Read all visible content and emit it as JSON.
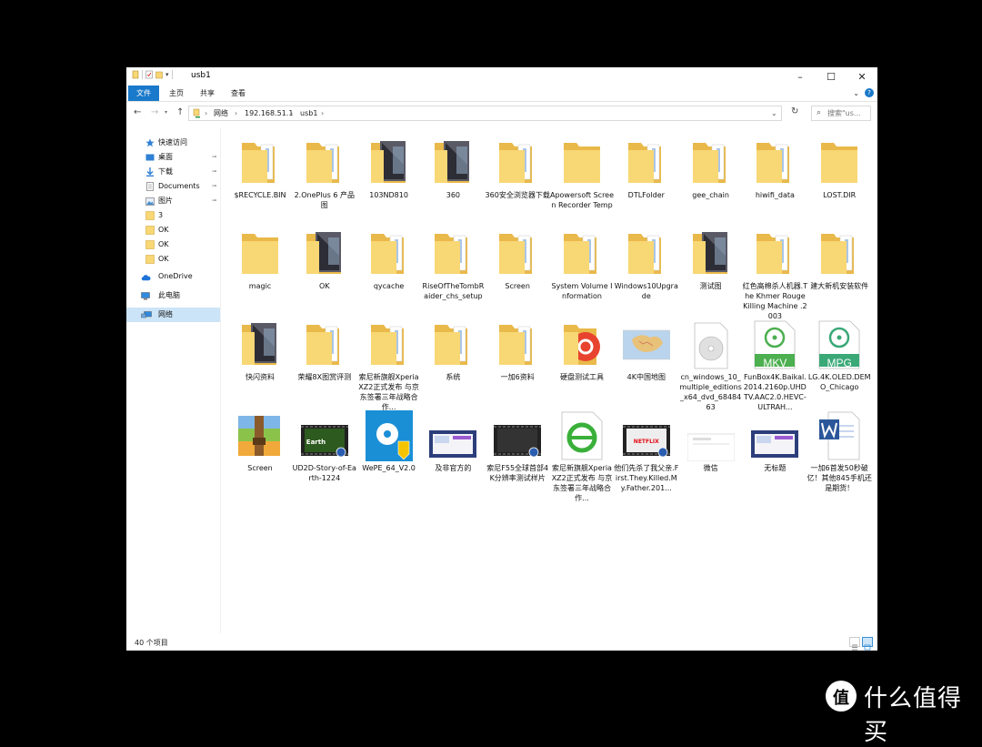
{
  "window": {
    "title": "usb1",
    "minimize": "–",
    "maximize": "☐",
    "close": "✕"
  },
  "ribbon": {
    "tabs": [
      "文件",
      "主页",
      "共享",
      "查看"
    ],
    "collapse": "⌄",
    "help": "?"
  },
  "address": {
    "crumbs": [
      "网络",
      "192.168.51.1",
      "usb1"
    ],
    "search_placeholder": "搜索\"us...",
    "back": "←",
    "forward": "→",
    "up": "↑",
    "refresh": "↻",
    "dropdown": "⌄"
  },
  "sidebar": {
    "items": [
      {
        "label": "快速访问",
        "icon": "star-icon",
        "pinned": false,
        "selected": false
      },
      {
        "label": "桌面",
        "icon": "desktop-icon",
        "pinned": true,
        "selected": false
      },
      {
        "label": "下载",
        "icon": "download-icon",
        "pinned": true,
        "selected": false
      },
      {
        "label": "Documents",
        "icon": "documents-icon",
        "pinned": true,
        "selected": false
      },
      {
        "label": "图片",
        "icon": "pictures-icon",
        "pinned": true,
        "selected": false
      },
      {
        "label": "3",
        "icon": "folder-icon",
        "pinned": false,
        "selected": false
      },
      {
        "label": "OK",
        "icon": "folder-icon",
        "pinned": false,
        "selected": false
      },
      {
        "label": "OK",
        "icon": "folder-icon",
        "pinned": false,
        "selected": false
      },
      {
        "label": "OK",
        "icon": "folder-icon",
        "pinned": false,
        "selected": false
      },
      {
        "label": "OneDrive",
        "icon": "cloud-icon",
        "pinned": false,
        "selected": false
      },
      {
        "label": "此电脑",
        "icon": "computer-icon",
        "pinned": false,
        "selected": false
      },
      {
        "label": "网络",
        "icon": "network-icon",
        "pinned": false,
        "selected": true
      }
    ],
    "pin_glyph": "📌"
  },
  "files": [
    {
      "name": "$RECYCLE.BIN",
      "type": "folder"
    },
    {
      "name": "2.OnePlus 6 产品图",
      "type": "folder"
    },
    {
      "name": "103ND810",
      "type": "folder-photo"
    },
    {
      "name": "360",
      "type": "folder-photo"
    },
    {
      "name": "360安全浏览器下载",
      "type": "folder"
    },
    {
      "name": "Apowersoft Screen Recorder Temp",
      "type": "folder-empty"
    },
    {
      "name": "DTLFolder",
      "type": "folder"
    },
    {
      "name": "gee_chain",
      "type": "folder"
    },
    {
      "name": "hiwifi_data",
      "type": "folder"
    },
    {
      "name": "LOST.DIR",
      "type": "folder-empty"
    },
    {
      "name": "magic",
      "type": "folder-empty"
    },
    {
      "name": "OK",
      "type": "folder-photo"
    },
    {
      "name": "qycache",
      "type": "folder"
    },
    {
      "name": "RiseOfTheTombRaider_chs_setup",
      "type": "folder"
    },
    {
      "name": "Screen",
      "type": "folder"
    },
    {
      "name": "System Volume Information",
      "type": "folder"
    },
    {
      "name": "Windows10Upgrade",
      "type": "folder"
    },
    {
      "name": "测试图",
      "type": "folder-photo"
    },
    {
      "name": "红色高棉杀人机器.The Khmer Rouge Killing Machine .2003",
      "type": "folder"
    },
    {
      "name": "建大新机安装软件",
      "type": "folder"
    },
    {
      "name": "快闪资料",
      "type": "folder-photo"
    },
    {
      "name": "荣耀8X图赏评测",
      "type": "folder"
    },
    {
      "name": "索尼新旗舰Xperia XZ2正式发布 与京东签署三年战略合作...",
      "type": "folder"
    },
    {
      "name": "系统",
      "type": "folder"
    },
    {
      "name": "一加6资料",
      "type": "folder"
    },
    {
      "name": "硬盘测试工具",
      "type": "folder-app"
    },
    {
      "name": "4K中国地图",
      "type": "image-map"
    },
    {
      "name": "cn_windows_10_multiple_editions_x64_dvd_6848463",
      "type": "disc"
    },
    {
      "name": "FunBox4K.Baikal.2014.2160p.UHDTV.AAC2.0.HEVC-ULTRAH...",
      "type": "video-mkv",
      "badge": "MKV"
    },
    {
      "name": "LG.4K.OLED.DEMO_Chicago",
      "type": "video-mpg",
      "badge": "MPG"
    },
    {
      "name": "Screen",
      "type": "archive"
    },
    {
      "name": "UD2D-Story-of-Earth-1224",
      "type": "video-thumb",
      "thumb_text": "Earth"
    },
    {
      "name": "WePE_64_V2.0",
      "type": "installer"
    },
    {
      "name": "及非官方的",
      "type": "image-screen"
    },
    {
      "name": "索尼F55全球首部4K分辨率测试样片",
      "type": "video-thumb"
    },
    {
      "name": "索尼新旗舰Xperia XZ2正式发布 与京东签署三年战略合作...",
      "type": "html-doc"
    },
    {
      "name": "他们先杀了我父亲.First.They.Killed.My.Father.201...",
      "type": "video-thumb",
      "thumb_text": "NETFLIX"
    },
    {
      "name": "微信",
      "type": "image-white"
    },
    {
      "name": "无标题",
      "type": "image-screen"
    },
    {
      "name": "一加6首发50秒破亿！其他845手机还是期货！",
      "type": "word-doc"
    }
  ],
  "status": {
    "count_text": "40 个项目"
  },
  "watermark": {
    "text": "什么值得买",
    "logo_glyph": "值"
  },
  "colors": {
    "folder": "#f8d775",
    "folder_dark": "#e9b94a",
    "accent": "#1979ca",
    "selected": "#cce4f7",
    "mkv": "#4caf50",
    "mpg": "#3aa877"
  }
}
